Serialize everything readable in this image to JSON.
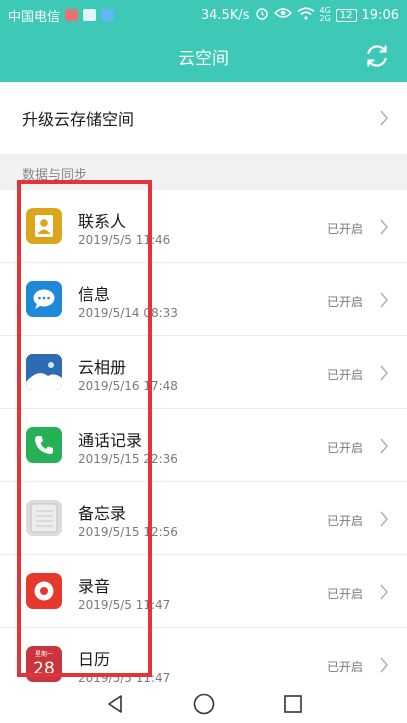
{
  "status_bar": {
    "carrier": "中国电信",
    "speed": "34.5K/s",
    "sig_top": "4G",
    "sig_bottom": "2G",
    "battery": "12",
    "time": "19:06"
  },
  "app_bar": {
    "title": "云空间"
  },
  "upgrade": {
    "label": "升级云存储空间"
  },
  "section": {
    "title": "数据与同步"
  },
  "items": [
    {
      "title": "联系人",
      "date": "2019/5/5 11:46",
      "status": "已开启",
      "icon": "contacts-icon",
      "color": "#dca51b"
    },
    {
      "title": "信息",
      "date": "2019/5/14 08:33",
      "status": "已开启",
      "icon": "message-icon",
      "color": "#1e88d9"
    },
    {
      "title": "云相册",
      "date": "2019/5/16 17:48",
      "status": "已开启",
      "icon": "gallery-icon",
      "color": "#2d6bb3"
    },
    {
      "title": "通话记录",
      "date": "2019/5/15 22:36",
      "status": "已开启",
      "icon": "phone-icon",
      "color": "#26b157"
    },
    {
      "title": "备忘录",
      "date": "2019/5/15 12:56",
      "status": "已开启",
      "icon": "notepad-icon",
      "color": "#dcdcdc"
    },
    {
      "title": "录音",
      "date": "2019/5/5 11:47",
      "status": "已开启",
      "icon": "recorder-icon",
      "color": "#e5392d"
    },
    {
      "title": "日历",
      "date": "2019/5/5 11:47",
      "status": "已开启",
      "icon": "calendar-icon",
      "color": "#c9353d",
      "cal_top": "星期一",
      "cal_day": "28"
    }
  ]
}
